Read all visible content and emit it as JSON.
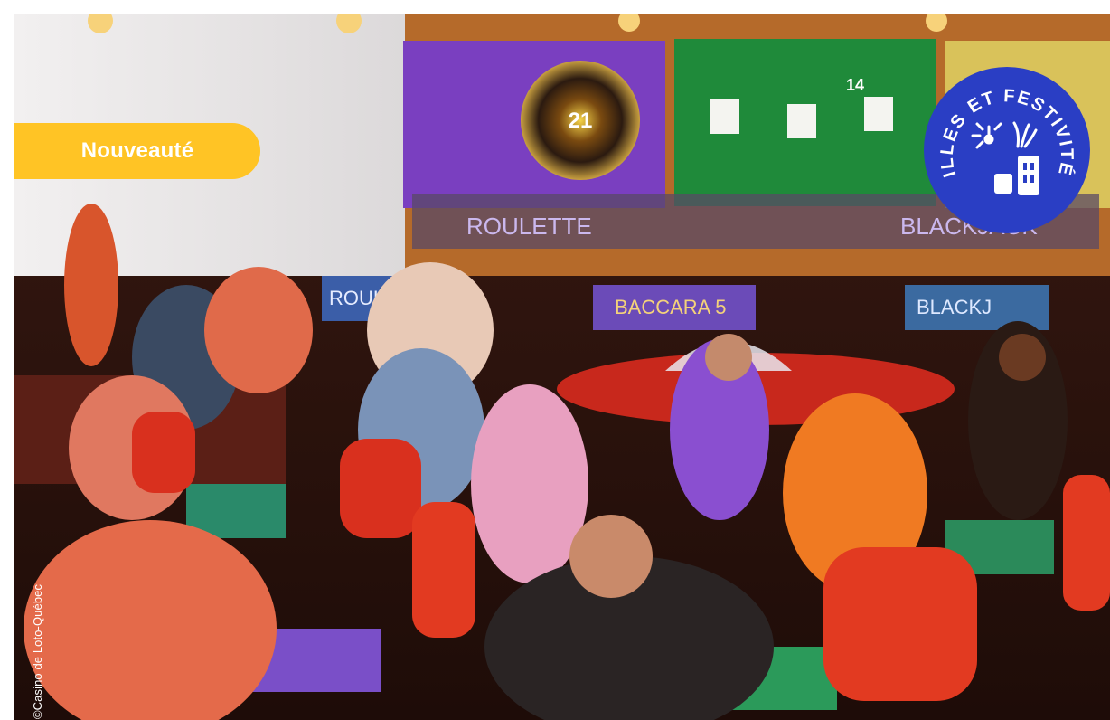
{
  "photo": {
    "subject": "casino-gaming-floor",
    "credit": "©Casino de Loto-Québec"
  },
  "badge": {
    "label": "Nouveauté",
    "color": "#ffc425"
  },
  "seal": {
    "text": "VILLES ET FESTIVITÉS",
    "color": "#2a3ec4",
    "icons": [
      "sun-icon",
      "firework-icon",
      "building-icon"
    ]
  },
  "screens": {
    "roulette_wheel_number": "21",
    "roulette_label": "ROULETTE",
    "blackjack_label": "BLACKJACK",
    "baccara_label": "BACCARA 5",
    "bj_count": "14"
  },
  "colors": {
    "seat_red": "#e23a21",
    "screen_purple": "#7a3fc0",
    "screen_green": "#1f8a3a"
  }
}
